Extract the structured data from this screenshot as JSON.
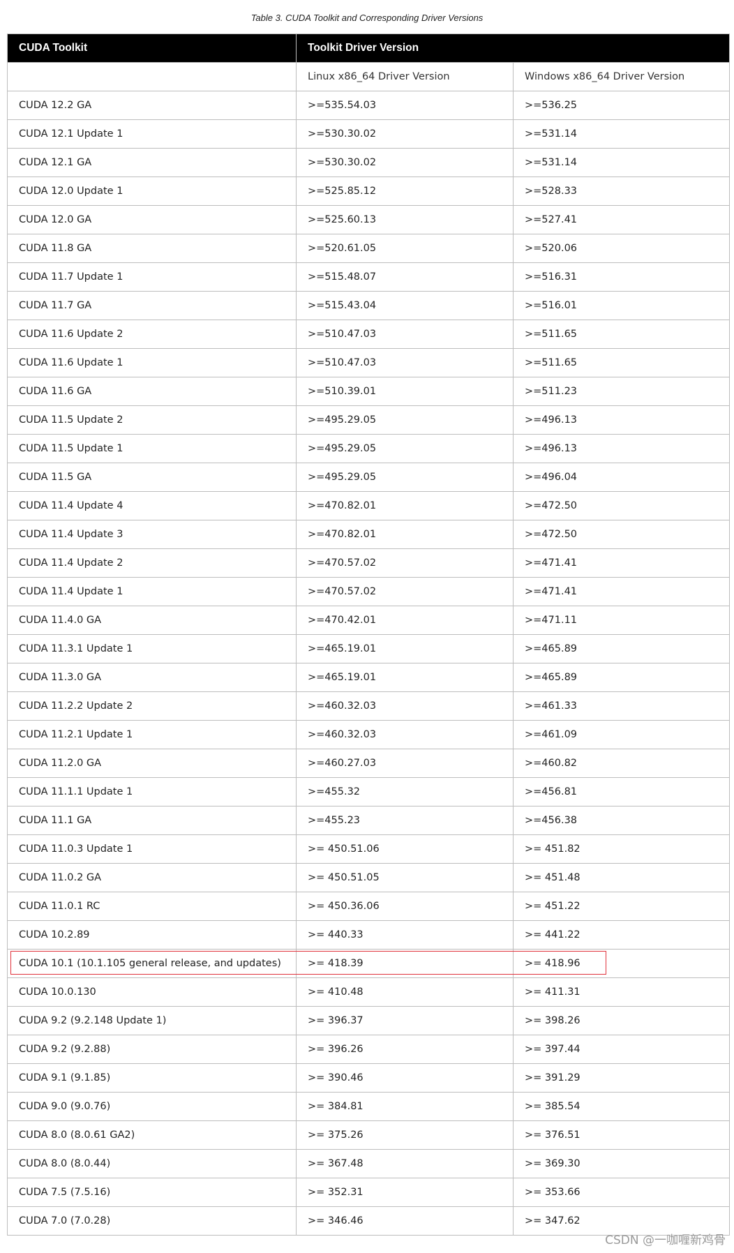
{
  "caption": "Table 3. CUDA Toolkit and Corresponding Driver Versions",
  "header": {
    "col1": "CUDA Toolkit",
    "col2": "Toolkit Driver Version"
  },
  "subheader": {
    "col1": "",
    "col2": "Linux x86_64 Driver Version",
    "col3": "Windows x86_64 Driver Version"
  },
  "rows": [
    [
      "CUDA 12.2 GA",
      ">=535.54.03",
      ">=536.25"
    ],
    [
      "CUDA 12.1 Update 1",
      ">=530.30.02",
      ">=531.14"
    ],
    [
      "CUDA 12.1 GA",
      ">=530.30.02",
      ">=531.14"
    ],
    [
      "CUDA 12.0 Update 1",
      ">=525.85.12",
      ">=528.33"
    ],
    [
      "CUDA 12.0 GA",
      ">=525.60.13",
      ">=527.41"
    ],
    [
      "CUDA 11.8 GA",
      ">=520.61.05",
      ">=520.06"
    ],
    [
      "CUDA 11.7 Update 1",
      ">=515.48.07",
      ">=516.31"
    ],
    [
      "CUDA 11.7 GA",
      ">=515.43.04",
      ">=516.01"
    ],
    [
      "CUDA 11.6 Update 2",
      ">=510.47.03",
      ">=511.65"
    ],
    [
      "CUDA 11.6 Update 1",
      ">=510.47.03",
      ">=511.65"
    ],
    [
      "CUDA 11.6 GA",
      ">=510.39.01",
      ">=511.23"
    ],
    [
      "CUDA 11.5 Update 2",
      ">=495.29.05",
      ">=496.13"
    ],
    [
      "CUDA 11.5 Update 1",
      ">=495.29.05",
      ">=496.13"
    ],
    [
      "CUDA 11.5 GA",
      ">=495.29.05",
      ">=496.04"
    ],
    [
      "CUDA 11.4 Update 4",
      ">=470.82.01",
      ">=472.50"
    ],
    [
      "CUDA 11.4 Update 3",
      ">=470.82.01",
      ">=472.50"
    ],
    [
      "CUDA 11.4 Update 2",
      ">=470.57.02",
      ">=471.41"
    ],
    [
      "CUDA 11.4 Update 1",
      ">=470.57.02",
      ">=471.41"
    ],
    [
      "CUDA 11.4.0 GA",
      ">=470.42.01",
      ">=471.11"
    ],
    [
      "CUDA 11.3.1 Update 1",
      ">=465.19.01",
      ">=465.89"
    ],
    [
      "CUDA 11.3.0 GA",
      ">=465.19.01",
      ">=465.89"
    ],
    [
      "CUDA 11.2.2 Update 2",
      ">=460.32.03",
      ">=461.33"
    ],
    [
      "CUDA 11.2.1 Update 1",
      ">=460.32.03",
      ">=461.09"
    ],
    [
      "CUDA 11.2.0 GA",
      ">=460.27.03",
      ">=460.82"
    ],
    [
      "CUDA 11.1.1 Update 1",
      ">=455.32",
      ">=456.81"
    ],
    [
      "CUDA 11.1 GA",
      ">=455.23",
      ">=456.38"
    ],
    [
      "CUDA 11.0.3 Update 1",
      ">= 450.51.06",
      ">= 451.82"
    ],
    [
      "CUDA 11.0.2 GA",
      ">= 450.51.05",
      ">= 451.48"
    ],
    [
      "CUDA 11.0.1 RC",
      ">= 450.36.06",
      ">= 451.22"
    ],
    [
      "CUDA 10.2.89",
      ">= 440.33",
      ">= 441.22"
    ],
    [
      "CUDA 10.1 (10.1.105 general release, and updates)",
      ">= 418.39",
      ">= 418.96"
    ],
    [
      "CUDA 10.0.130",
      ">= 410.48",
      ">= 411.31"
    ],
    [
      "CUDA 9.2 (9.2.148 Update 1)",
      ">= 396.37",
      ">= 398.26"
    ],
    [
      "CUDA 9.2 (9.2.88)",
      ">= 396.26",
      ">= 397.44"
    ],
    [
      "CUDA 9.1 (9.1.85)",
      ">= 390.46",
      ">= 391.29"
    ],
    [
      "CUDA 9.0 (9.0.76)",
      ">= 384.81",
      ">= 385.54"
    ],
    [
      "CUDA 8.0 (8.0.61 GA2)",
      ">= 375.26",
      ">= 376.51"
    ],
    [
      "CUDA 8.0 (8.0.44)",
      ">= 367.48",
      ">= 369.30"
    ],
    [
      "CUDA 7.5 (7.5.16)",
      ">= 352.31",
      ">= 353.66"
    ],
    [
      "CUDA 7.0 (7.0.28)",
      ">= 346.46",
      ">= 347.62"
    ]
  ],
  "highlight_color": "#e0303a",
  "watermark": "CSDN @一咖喱新鸡骨"
}
